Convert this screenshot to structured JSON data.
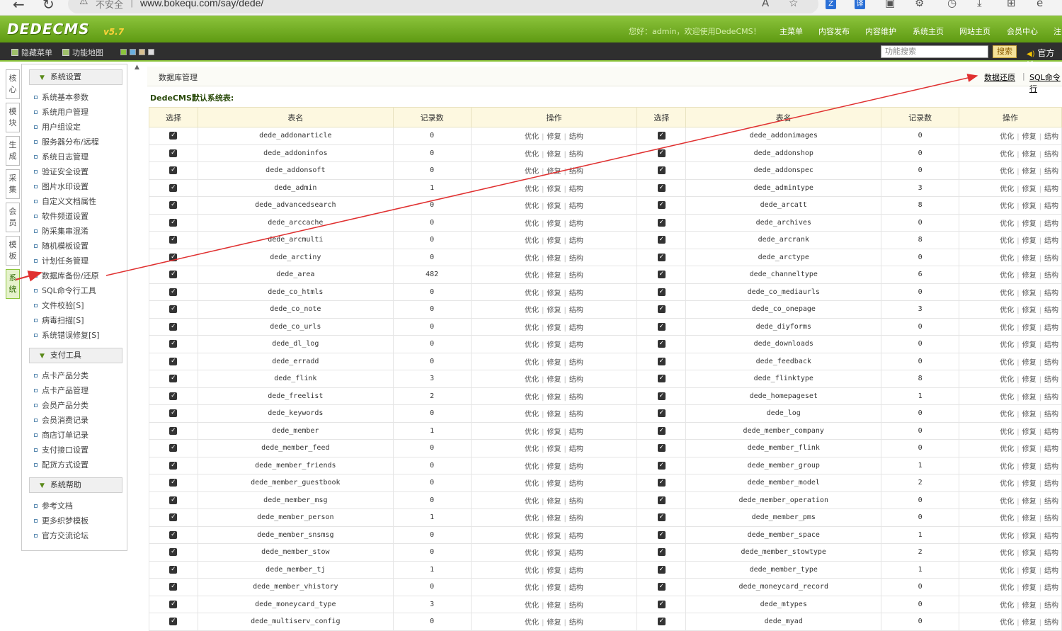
{
  "browser": {
    "security_warning": "不安全",
    "url": "www.bokequ.com/say/dede/",
    "translate_label": "译"
  },
  "header": {
    "logo": "DEDECMS",
    "version": "v5.7",
    "welcome": "您好：admin，欢迎使用DedeCMS！",
    "menu": [
      "主菜单",
      "内容发布",
      "内容维护",
      "系统主页",
      "网站主页",
      "会员中心",
      "注"
    ]
  },
  "toolbar": {
    "hide_menu": "隐藏菜单",
    "func_map": "功能地图",
    "search_placeholder": "功能搜索",
    "search_btn": "搜索",
    "forum": "官方论"
  },
  "vtabs": [
    "核心",
    "模块",
    "生成",
    "采集",
    "会员",
    "模板",
    "系统"
  ],
  "sidebar": {
    "groups": [
      {
        "title": "系统设置",
        "items": [
          "系统基本参数",
          "系统用户管理",
          "用户组设定",
          "服务器分布/远程",
          "系统日志管理",
          "验证安全设置",
          "图片水印设置",
          "自定义文档属性",
          "软件频道设置",
          "防采集串混淆",
          "随机模板设置",
          "计划任务管理",
          "数据库备份/还原",
          "SQL命令行工具",
          "文件校验[S]",
          "病毒扫描[S]",
          "系统错误修复[S]"
        ]
      },
      {
        "title": "支付工具",
        "items": [
          "点卡产品分类",
          "点卡产品管理",
          "会员产品分类",
          "会员消费记录",
          "商店订单记录",
          "支付接口设置",
          "配货方式设置"
        ]
      },
      {
        "title": "系统帮助",
        "items": [
          "参考文档",
          "更多织梦模板",
          "官方交流论坛"
        ]
      }
    ]
  },
  "main": {
    "title": "数据库管理",
    "restore_link": "数据还原",
    "sql_link": "SQL命令行",
    "subtitle": "DedeCMS默认系统表:",
    "headers": [
      "选择",
      "表名",
      "记录数",
      "操作",
      "选择",
      "表名",
      "记录数",
      "操作"
    ],
    "op_labels": [
      "优化",
      "修复",
      "结构"
    ],
    "check_mark": "✓",
    "rows": [
      [
        [
          "dede_addonarticle",
          "0"
        ],
        [
          "dede_addonimages",
          "0"
        ]
      ],
      [
        [
          "dede_addoninfos",
          "0"
        ],
        [
          "dede_addonshop",
          "0"
        ]
      ],
      [
        [
          "dede_addonsoft",
          "0"
        ],
        [
          "dede_addonspec",
          "0"
        ]
      ],
      [
        [
          "dede_admin",
          "1"
        ],
        [
          "dede_admintype",
          "3"
        ]
      ],
      [
        [
          "dede_advancedsearch",
          "0"
        ],
        [
          "dede_arcatt",
          "8"
        ]
      ],
      [
        [
          "dede_arccache",
          "0"
        ],
        [
          "dede_archives",
          "0"
        ]
      ],
      [
        [
          "dede_arcmulti",
          "0"
        ],
        [
          "dede_arcrank",
          "8"
        ]
      ],
      [
        [
          "dede_arctiny",
          "0"
        ],
        [
          "dede_arctype",
          "0"
        ]
      ],
      [
        [
          "dede_area",
          "482"
        ],
        [
          "dede_channeltype",
          "6"
        ]
      ],
      [
        [
          "dede_co_htmls",
          "0"
        ],
        [
          "dede_co_mediaurls",
          "0"
        ]
      ],
      [
        [
          "dede_co_note",
          "0"
        ],
        [
          "dede_co_onepage",
          "3"
        ]
      ],
      [
        [
          "dede_co_urls",
          "0"
        ],
        [
          "dede_diyforms",
          "0"
        ]
      ],
      [
        [
          "dede_dl_log",
          "0"
        ],
        [
          "dede_downloads",
          "0"
        ]
      ],
      [
        [
          "dede_erradd",
          "0"
        ],
        [
          "dede_feedback",
          "0"
        ]
      ],
      [
        [
          "dede_flink",
          "3"
        ],
        [
          "dede_flinktype",
          "8"
        ]
      ],
      [
        [
          "dede_freelist",
          "2"
        ],
        [
          "dede_homepageset",
          "1"
        ]
      ],
      [
        [
          "dede_keywords",
          "0"
        ],
        [
          "dede_log",
          "0"
        ]
      ],
      [
        [
          "dede_member",
          "1"
        ],
        [
          "dede_member_company",
          "0"
        ]
      ],
      [
        [
          "dede_member_feed",
          "0"
        ],
        [
          "dede_member_flink",
          "0"
        ]
      ],
      [
        [
          "dede_member_friends",
          "0"
        ],
        [
          "dede_member_group",
          "1"
        ]
      ],
      [
        [
          "dede_member_guestbook",
          "0"
        ],
        [
          "dede_member_model",
          "2"
        ]
      ],
      [
        [
          "dede_member_msg",
          "0"
        ],
        [
          "dede_member_operation",
          "0"
        ]
      ],
      [
        [
          "dede_member_person",
          "1"
        ],
        [
          "dede_member_pms",
          "0"
        ]
      ],
      [
        [
          "dede_member_snsmsg",
          "0"
        ],
        [
          "dede_member_space",
          "1"
        ]
      ],
      [
        [
          "dede_member_stow",
          "0"
        ],
        [
          "dede_member_stowtype",
          "2"
        ]
      ],
      [
        [
          "dede_member_tj",
          "1"
        ],
        [
          "dede_member_type",
          "1"
        ]
      ],
      [
        [
          "dede_member_vhistory",
          "0"
        ],
        [
          "dede_moneycard_record",
          "0"
        ]
      ],
      [
        [
          "dede_moneycard_type",
          "3"
        ],
        [
          "dede_mtypes",
          "0"
        ]
      ],
      [
        [
          "dede_multiserv_config",
          "0"
        ],
        [
          "dede_myad",
          "0"
        ]
      ]
    ]
  },
  "colors": {
    "header_green": "#6aa61c",
    "toolbar_dark": "#2f2f2f",
    "table_header": "#fdf8e0",
    "annotation_arrow": "#e03030"
  }
}
